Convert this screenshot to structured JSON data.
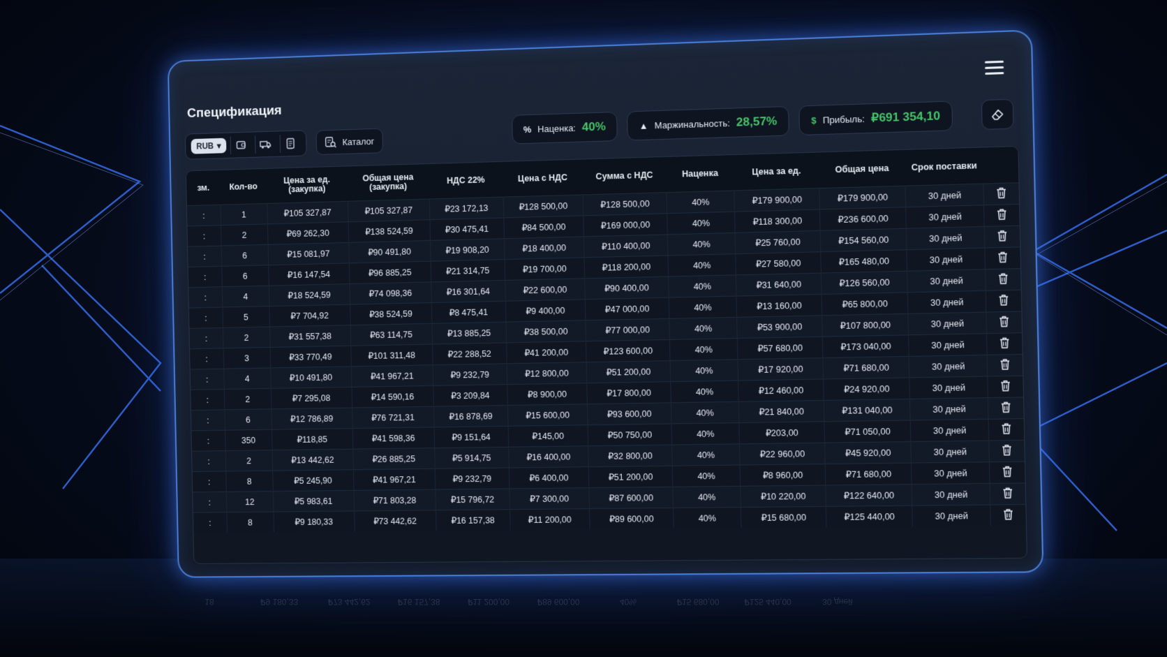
{
  "app": {
    "title": "Спецификация"
  },
  "toolbar": {
    "currency": "RUB",
    "catalog_label": "Каталог"
  },
  "stats": {
    "markup": {
      "symbol": "%",
      "label": "Наценка:",
      "value": "40%"
    },
    "margin": {
      "symbol": "▲",
      "label": "Маржинальность:",
      "value": "28,57%"
    },
    "profit": {
      "symbol": "$",
      "label": "Прибыль:",
      "value": "₽691 354,10"
    }
  },
  "table": {
    "headers": {
      "ed": "зм.",
      "qty": "Кол-во",
      "unit_price_purchase": "Цена за ед. (закупка)",
      "total_purchase": "Общая цена (закупка)",
      "vat": "НДС 22%",
      "price_vat": "Цена с НДС",
      "sum_vat": "Сумма с НДС",
      "markup": "Наценка",
      "unit_price": "Цена за ед.",
      "total_price": "Общая цена",
      "term": "Срок поставки"
    },
    "rows": [
      {
        "ed": ":",
        "qty": "1",
        "p1": "₽105 327,87",
        "p2": "₽105 327,87",
        "vat": "₽23 172,13",
        "pv": "₽128 500,00",
        "sv": "₽128 500,00",
        "mk": "40%",
        "pu": "₽179 900,00",
        "tp": "₽179 900,00",
        "term": "30 дней"
      },
      {
        "ed": ":",
        "qty": "2",
        "p1": "₽69 262,30",
        "p2": "₽138 524,59",
        "vat": "₽30 475,41",
        "pv": "₽84 500,00",
        "sv": "₽169 000,00",
        "mk": "40%",
        "pu": "₽118 300,00",
        "tp": "₽236 600,00",
        "term": "30 дней"
      },
      {
        "ed": ":",
        "qty": "6",
        "p1": "₽15 081,97",
        "p2": "₽90 491,80",
        "vat": "₽19 908,20",
        "pv": "₽18 400,00",
        "sv": "₽110 400,00",
        "mk": "40%",
        "pu": "₽25 760,00",
        "tp": "₽154 560,00",
        "term": "30 дней"
      },
      {
        "ed": ":",
        "qty": "6",
        "p1": "₽16 147,54",
        "p2": "₽96 885,25",
        "vat": "₽21 314,75",
        "pv": "₽19 700,00",
        "sv": "₽118 200,00",
        "mk": "40%",
        "pu": "₽27 580,00",
        "tp": "₽165 480,00",
        "term": "30 дней"
      },
      {
        "ed": ":",
        "qty": "4",
        "p1": "₽18 524,59",
        "p2": "₽74 098,36",
        "vat": "₽16 301,64",
        "pv": "₽22 600,00",
        "sv": "₽90 400,00",
        "mk": "40%",
        "pu": "₽31 640,00",
        "tp": "₽126 560,00",
        "term": "30 дней"
      },
      {
        "ed": ":",
        "qty": "5",
        "p1": "₽7 704,92",
        "p2": "₽38 524,59",
        "vat": "₽8 475,41",
        "pv": "₽9 400,00",
        "sv": "₽47 000,00",
        "mk": "40%",
        "pu": "₽13 160,00",
        "tp": "₽65 800,00",
        "term": "30 дней"
      },
      {
        "ed": ":",
        "qty": "2",
        "p1": "₽31 557,38",
        "p2": "₽63 114,75",
        "vat": "₽13 885,25",
        "pv": "₽38 500,00",
        "sv": "₽77 000,00",
        "mk": "40%",
        "pu": "₽53 900,00",
        "tp": "₽107 800,00",
        "term": "30 дней"
      },
      {
        "ed": ":",
        "qty": "3",
        "p1": "₽33 770,49",
        "p2": "₽101 311,48",
        "vat": "₽22 288,52",
        "pv": "₽41 200,00",
        "sv": "₽123 600,00",
        "mk": "40%",
        "pu": "₽57 680,00",
        "tp": "₽173 040,00",
        "term": "30 дней"
      },
      {
        "ed": ":",
        "qty": "4",
        "p1": "₽10 491,80",
        "p2": "₽41 967,21",
        "vat": "₽9 232,79",
        "pv": "₽12 800,00",
        "sv": "₽51 200,00",
        "mk": "40%",
        "pu": "₽17 920,00",
        "tp": "₽71 680,00",
        "term": "30 дней"
      },
      {
        "ed": ":",
        "qty": "2",
        "p1": "₽7 295,08",
        "p2": "₽14 590,16",
        "vat": "₽3 209,84",
        "pv": "₽8 900,00",
        "sv": "₽17 800,00",
        "mk": "40%",
        "pu": "₽12 460,00",
        "tp": "₽24 920,00",
        "term": "30 дней"
      },
      {
        "ed": ":",
        "qty": "6",
        "p1": "₽12 786,89",
        "p2": "₽76 721,31",
        "vat": "₽16 878,69",
        "pv": "₽15 600,00",
        "sv": "₽93 600,00",
        "mk": "40%",
        "pu": "₽21 840,00",
        "tp": "₽131 040,00",
        "term": "30 дней"
      },
      {
        "ed": ":",
        "qty": "350",
        "p1": "₽118,85",
        "p2": "₽41 598,36",
        "vat": "₽9 151,64",
        "pv": "₽145,00",
        "sv": "₽50 750,00",
        "mk": "40%",
        "pu": "₽203,00",
        "tp": "₽71 050,00",
        "term": "30 дней"
      },
      {
        "ed": ":",
        "qty": "2",
        "p1": "₽13 442,62",
        "p2": "₽26 885,25",
        "vat": "₽5 914,75",
        "pv": "₽16 400,00",
        "sv": "₽32 800,00",
        "mk": "40%",
        "pu": "₽22 960,00",
        "tp": "₽45 920,00",
        "term": "30 дней"
      },
      {
        "ed": ":",
        "qty": "8",
        "p1": "₽5 245,90",
        "p2": "₽41 967,21",
        "vat": "₽9 232,79",
        "pv": "₽6 400,00",
        "sv": "₽51 200,00",
        "mk": "40%",
        "pu": "₽8 960,00",
        "tp": "₽71 680,00",
        "term": "30 дней"
      },
      {
        "ed": ":",
        "qty": "12",
        "p1": "₽5 983,61",
        "p2": "₽71 803,28",
        "vat": "₽15 796,72",
        "pv": "₽7 300,00",
        "sv": "₽87 600,00",
        "mk": "40%",
        "pu": "₽10 220,00",
        "tp": "₽122 640,00",
        "term": "30 дней"
      },
      {
        "ed": ":",
        "qty": "8",
        "p1": "₽9 180,33",
        "p2": "₽73 442,62",
        "vat": "₽16 157,38",
        "pv": "₽11 200,00",
        "sv": "₽89 600,00",
        "mk": "40%",
        "pu": "₽15 680,00",
        "tp": "₽125 440,00",
        "term": "30 дней"
      }
    ]
  },
  "reflection": {
    "cells": [
      "18",
      "₽9 180,33",
      "₽73 442,62",
      "₽16 157,38",
      "₽11 200,00",
      "₽89 600,00",
      "40%",
      "₽15 680,00",
      "₽125 440,00",
      "30 дней"
    ]
  },
  "colors": {
    "accent": "#4a7fd8",
    "positive": "#49c46b",
    "panel_bg": "#141c2a"
  }
}
